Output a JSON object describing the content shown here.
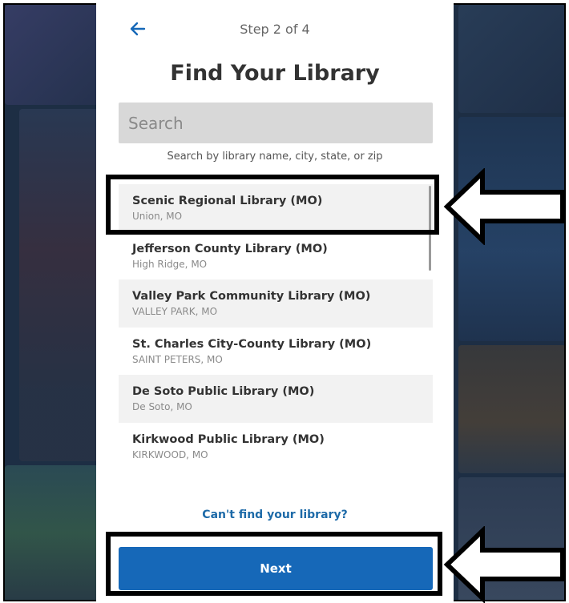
{
  "header": {
    "step_text": "Step 2 of 4",
    "title": "Find Your Library",
    "back_icon": "arrow-left-icon"
  },
  "search": {
    "placeholder": "Search",
    "value": "",
    "hint": "Search by library name, city, state, or zip"
  },
  "libraries": [
    {
      "name": "Scenic Regional Library (MO)",
      "location": "Union, MO"
    },
    {
      "name": "Jefferson County Library (MO)",
      "location": "High Ridge, MO"
    },
    {
      "name": "Valley Park Community Library (MO)",
      "location": "VALLEY PARK, MO"
    },
    {
      "name": "St. Charles City-County Library (MO)",
      "location": "SAINT PETERS, MO"
    },
    {
      "name": "De Soto Public Library (MO)",
      "location": "De Soto, MO"
    },
    {
      "name": "Kirkwood Public Library (MO)",
      "location": "KIRKWOOD, MO"
    }
  ],
  "footer": {
    "cant_find": "Can't find your library?",
    "next_label": "Next"
  },
  "colors": {
    "accent": "#1668b8",
    "link": "#1d6aa8"
  }
}
